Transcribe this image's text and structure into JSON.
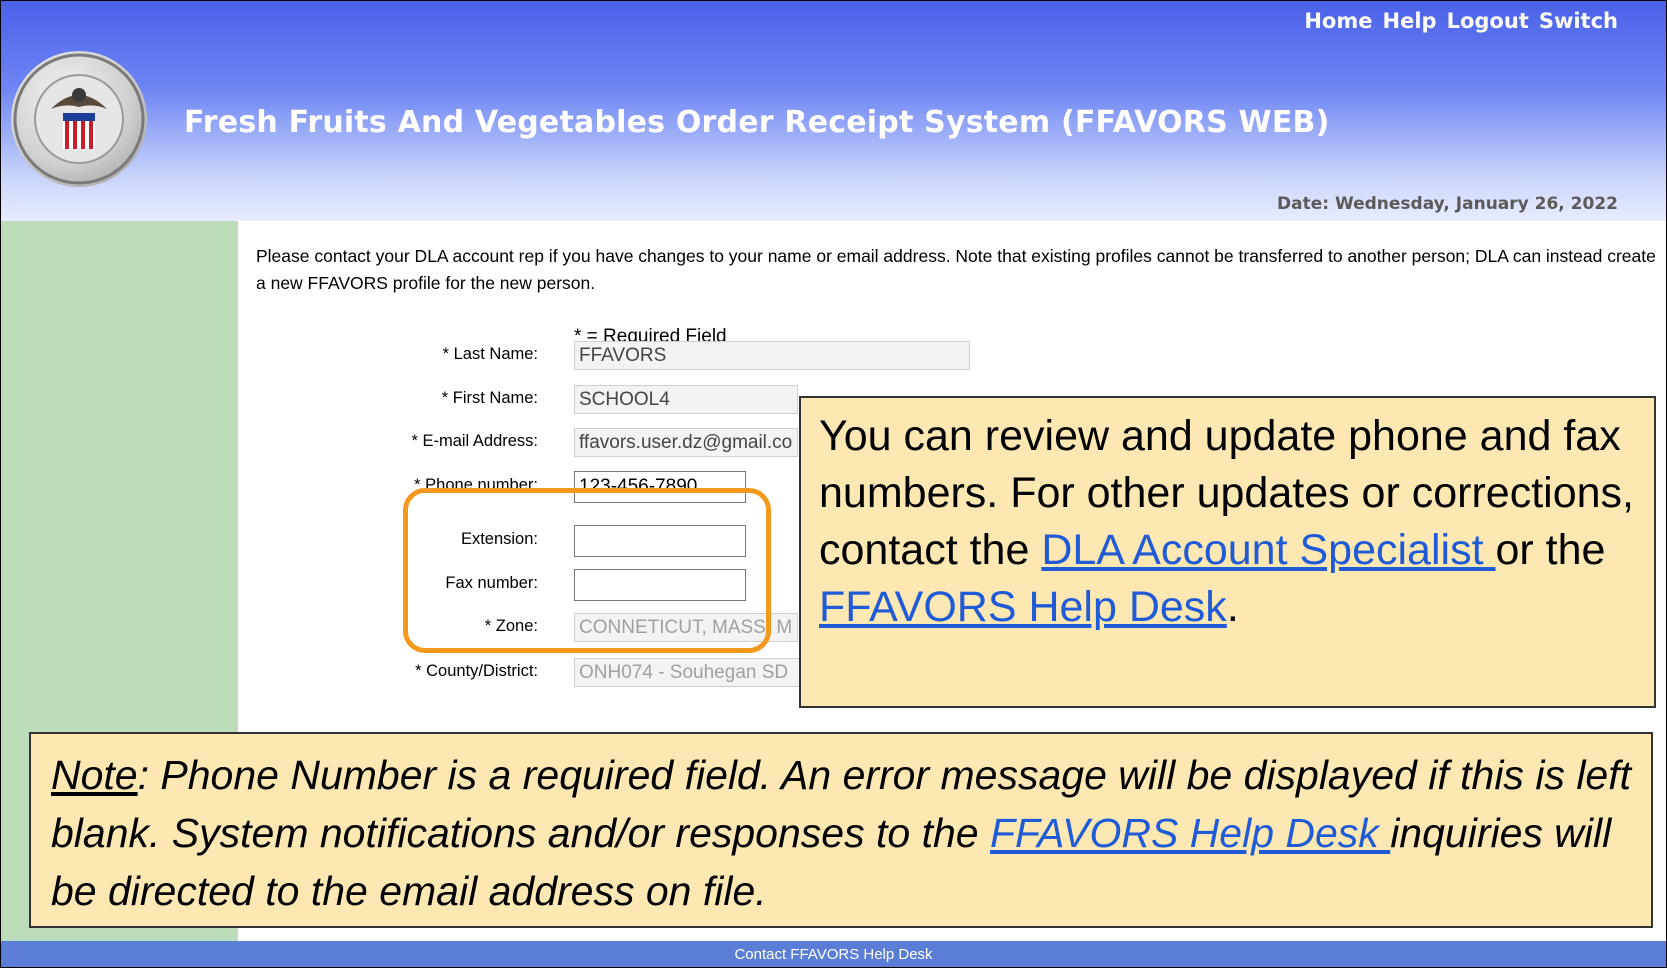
{
  "header": {
    "links": {
      "home": "Home",
      "help": "Help",
      "logout": "Logout",
      "switch": "Switch"
    },
    "title": "Fresh  Fruits  And  Vegetables  Order  Receipt  System (FFAVORS WEB)",
    "date": "Date: Wednesday, January 26, 2022",
    "seal_icon": "dla-seal-icon"
  },
  "form": {
    "intro": "Please contact your DLA account rep if you have changes to your name or email address. Note that existing profiles cannot be transferred to another person; DLA can instead create a new FFAVORS profile for the new person.",
    "required_legend": "* = Required Field",
    "last_name_label": "* Last Name:",
    "last_name_value": "FFAVORS",
    "first_name_label": "* First Name:",
    "first_name_value": "SCHOOL4",
    "email_label": "* E-mail Address:",
    "email_value": "ffavors.user.dz@gmail.co",
    "phone_label": "* Phone number:",
    "phone_value": "123-456-7890",
    "extension_label": "Extension:",
    "extension_value": "",
    "fax_label": "Fax number:",
    "fax_value": "",
    "zone_label": "* Zone:",
    "zone_value": "CONNETICUT, MASS, M",
    "county_label": "* County/District:",
    "county_value": "ONH074 - Souhegan SD"
  },
  "callout": {
    "text_1": "You can review and update phone and fax numbers. For other updates or corrections, contact the ",
    "link_1": "DLA Account Specialist ",
    "text_2": "or the ",
    "link_2": "FFAVORS Help Desk",
    "text_3": "."
  },
  "note": {
    "label": "Note",
    "text_1": ":  Phone Number is a required field. An error message will be displayed if this is left blank. System notifications and/or responses to the ",
    "link": "FFAVORS Help Desk ",
    "text_2": "inquiries will be directed to the email address on file."
  },
  "footer": {
    "link": "Contact FFAVORS Help Desk"
  },
  "colors": {
    "header_blue": "#4a60e8",
    "sidebar_green": "#bcdcbc",
    "callout_fill": "#fde7b2",
    "highlight_orange": "#f39a1e",
    "footer_blue": "#5a7ed6"
  }
}
